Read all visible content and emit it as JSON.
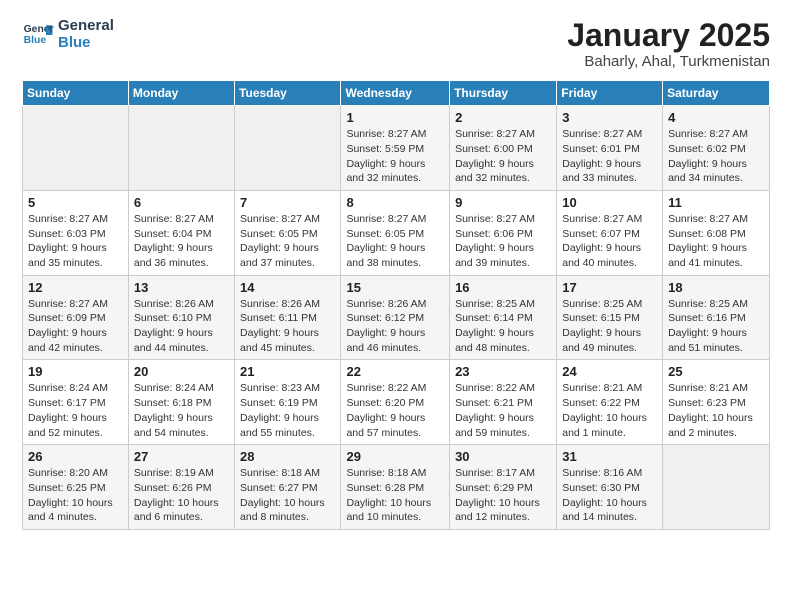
{
  "logo": {
    "line1": "General",
    "line2": "Blue"
  },
  "title": "January 2025",
  "subtitle": "Baharly, Ahal, Turkmenistan",
  "weekdays": [
    "Sunday",
    "Monday",
    "Tuesday",
    "Wednesday",
    "Thursday",
    "Friday",
    "Saturday"
  ],
  "weeks": [
    [
      {
        "day": "",
        "info": ""
      },
      {
        "day": "",
        "info": ""
      },
      {
        "day": "",
        "info": ""
      },
      {
        "day": "1",
        "info": "Sunrise: 8:27 AM\nSunset: 5:59 PM\nDaylight: 9 hours\nand 32 minutes."
      },
      {
        "day": "2",
        "info": "Sunrise: 8:27 AM\nSunset: 6:00 PM\nDaylight: 9 hours\nand 32 minutes."
      },
      {
        "day": "3",
        "info": "Sunrise: 8:27 AM\nSunset: 6:01 PM\nDaylight: 9 hours\nand 33 minutes."
      },
      {
        "day": "4",
        "info": "Sunrise: 8:27 AM\nSunset: 6:02 PM\nDaylight: 9 hours\nand 34 minutes."
      }
    ],
    [
      {
        "day": "5",
        "info": "Sunrise: 8:27 AM\nSunset: 6:03 PM\nDaylight: 9 hours\nand 35 minutes."
      },
      {
        "day": "6",
        "info": "Sunrise: 8:27 AM\nSunset: 6:04 PM\nDaylight: 9 hours\nand 36 minutes."
      },
      {
        "day": "7",
        "info": "Sunrise: 8:27 AM\nSunset: 6:05 PM\nDaylight: 9 hours\nand 37 minutes."
      },
      {
        "day": "8",
        "info": "Sunrise: 8:27 AM\nSunset: 6:05 PM\nDaylight: 9 hours\nand 38 minutes."
      },
      {
        "day": "9",
        "info": "Sunrise: 8:27 AM\nSunset: 6:06 PM\nDaylight: 9 hours\nand 39 minutes."
      },
      {
        "day": "10",
        "info": "Sunrise: 8:27 AM\nSunset: 6:07 PM\nDaylight: 9 hours\nand 40 minutes."
      },
      {
        "day": "11",
        "info": "Sunrise: 8:27 AM\nSunset: 6:08 PM\nDaylight: 9 hours\nand 41 minutes."
      }
    ],
    [
      {
        "day": "12",
        "info": "Sunrise: 8:27 AM\nSunset: 6:09 PM\nDaylight: 9 hours\nand 42 minutes."
      },
      {
        "day": "13",
        "info": "Sunrise: 8:26 AM\nSunset: 6:10 PM\nDaylight: 9 hours\nand 44 minutes."
      },
      {
        "day": "14",
        "info": "Sunrise: 8:26 AM\nSunset: 6:11 PM\nDaylight: 9 hours\nand 45 minutes."
      },
      {
        "day": "15",
        "info": "Sunrise: 8:26 AM\nSunset: 6:12 PM\nDaylight: 9 hours\nand 46 minutes."
      },
      {
        "day": "16",
        "info": "Sunrise: 8:25 AM\nSunset: 6:14 PM\nDaylight: 9 hours\nand 48 minutes."
      },
      {
        "day": "17",
        "info": "Sunrise: 8:25 AM\nSunset: 6:15 PM\nDaylight: 9 hours\nand 49 minutes."
      },
      {
        "day": "18",
        "info": "Sunrise: 8:25 AM\nSunset: 6:16 PM\nDaylight: 9 hours\nand 51 minutes."
      }
    ],
    [
      {
        "day": "19",
        "info": "Sunrise: 8:24 AM\nSunset: 6:17 PM\nDaylight: 9 hours\nand 52 minutes."
      },
      {
        "day": "20",
        "info": "Sunrise: 8:24 AM\nSunset: 6:18 PM\nDaylight: 9 hours\nand 54 minutes."
      },
      {
        "day": "21",
        "info": "Sunrise: 8:23 AM\nSunset: 6:19 PM\nDaylight: 9 hours\nand 55 minutes."
      },
      {
        "day": "22",
        "info": "Sunrise: 8:22 AM\nSunset: 6:20 PM\nDaylight: 9 hours\nand 57 minutes."
      },
      {
        "day": "23",
        "info": "Sunrise: 8:22 AM\nSunset: 6:21 PM\nDaylight: 9 hours\nand 59 minutes."
      },
      {
        "day": "24",
        "info": "Sunrise: 8:21 AM\nSunset: 6:22 PM\nDaylight: 10 hours\nand 1 minute."
      },
      {
        "day": "25",
        "info": "Sunrise: 8:21 AM\nSunset: 6:23 PM\nDaylight: 10 hours\nand 2 minutes."
      }
    ],
    [
      {
        "day": "26",
        "info": "Sunrise: 8:20 AM\nSunset: 6:25 PM\nDaylight: 10 hours\nand 4 minutes."
      },
      {
        "day": "27",
        "info": "Sunrise: 8:19 AM\nSunset: 6:26 PM\nDaylight: 10 hours\nand 6 minutes."
      },
      {
        "day": "28",
        "info": "Sunrise: 8:18 AM\nSunset: 6:27 PM\nDaylight: 10 hours\nand 8 minutes."
      },
      {
        "day": "29",
        "info": "Sunrise: 8:18 AM\nSunset: 6:28 PM\nDaylight: 10 hours\nand 10 minutes."
      },
      {
        "day": "30",
        "info": "Sunrise: 8:17 AM\nSunset: 6:29 PM\nDaylight: 10 hours\nand 12 minutes."
      },
      {
        "day": "31",
        "info": "Sunrise: 8:16 AM\nSunset: 6:30 PM\nDaylight: 10 hours\nand 14 minutes."
      },
      {
        "day": "",
        "info": ""
      }
    ]
  ]
}
